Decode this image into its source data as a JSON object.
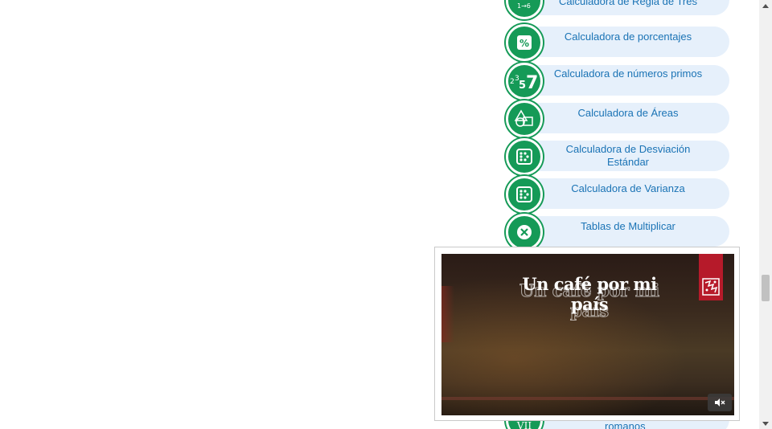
{
  "calculators": [
    {
      "label": "Calculadora de Regla de Tres",
      "icon": "rule-of-three-icon"
    },
    {
      "label": "Calculadora de porcentajes",
      "icon": "percent-icon"
    },
    {
      "label": "Calculadora de números primos",
      "icon": "prime-numbers-icon"
    },
    {
      "label": "Calculadora de Áreas",
      "icon": "shapes-area-icon"
    },
    {
      "label": "Calculadora de Desviación Estándar",
      "icon": "dice-stats-icon"
    },
    {
      "label": "Calculadora de Varianza",
      "icon": "dice-stats-icon"
    },
    {
      "label": "Tablas de Multiplicar",
      "icon": "multiply-icon"
    }
  ],
  "partial_bottom": {
    "label": "romanos",
    "icon_text": "VII"
  },
  "video": {
    "title": "Un café por mi país",
    "brand_color": "#b61a2a"
  },
  "colors": {
    "accent_green": "#159a57",
    "pill_bg": "#e6f0fb",
    "link_blue": "#1a73b5"
  }
}
